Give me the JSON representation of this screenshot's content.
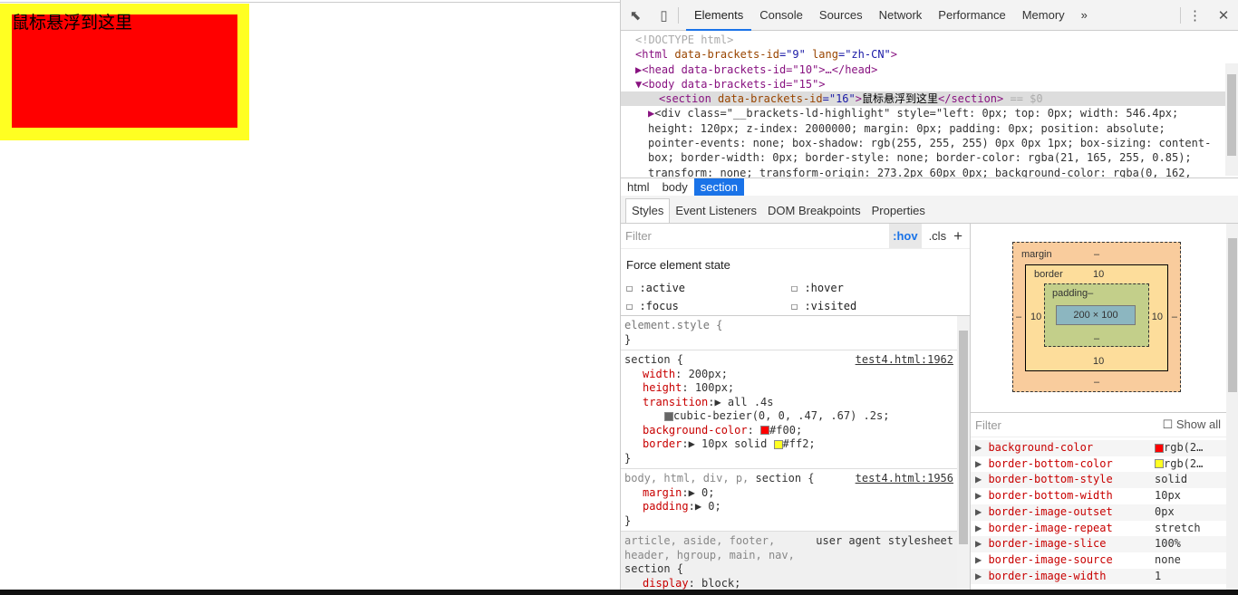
{
  "page": {
    "section_text": "鼠标悬浮到这里",
    "colors": {
      "background": "#ff0000",
      "border": "#ffff22"
    }
  },
  "devtools": {
    "tabs": [
      "Elements",
      "Console",
      "Sources",
      "Network",
      "Performance",
      "Memory"
    ],
    "more": "»",
    "dom": {
      "doctype": "<!DOCTYPE html>",
      "html_line": [
        "<html ",
        "data-brackets-id",
        "=\"9\" ",
        "lang",
        "=\"zh-CN\"",
        ">"
      ],
      "head_line": "<head data-brackets-id=\"10\">…</head>",
      "body_line": "<body data-brackets-id=\"15\">",
      "section_open": "<section ",
      "section_attr": "data-brackets-id",
      "section_val": "=\"16\"",
      "section_text": "鼠标悬浮到这里",
      "section_close": "</section>",
      "section_eq": " == $0",
      "div_lines": [
        "<div class=\"__brackets-ld-highlight\" style=\"left: 0px; top: 0px; width: 546.4px;",
        "height: 120px; z-index: 2000000; margin: 0px; padding: 0px; position: absolute;",
        "pointer-events: none; box-shadow: rgb(255, 255, 255) 0px 0px 1px; box-sizing: content-",
        "box; border-width: 0px; border-style: none; border-color: rgba(21, 165, 255, 0.85);",
        "transform: none; transform-origin: 273.2px 60px 0px; background-color: rgba(0, 162,"
      ]
    },
    "breadcrumbs": [
      "html",
      "body",
      "section"
    ],
    "subtabs": [
      "Styles",
      "Event Listeners",
      "DOM Breakpoints",
      "Properties"
    ],
    "styles": {
      "filter_placeholder": "Filter",
      "hov": ":hov",
      "cls": ".cls",
      "add": "+",
      "force_state": "Force element state",
      "states": [
        ":active",
        ":hover",
        ":focus",
        ":visited"
      ],
      "element_style": "element.style {",
      "close": "}",
      "rule1": {
        "selector": "section {",
        "source": "test4.html:1962",
        "props": [
          [
            "width",
            "200px;"
          ],
          [
            "height",
            "100px;"
          ],
          [
            "transition",
            "▶ all .4s"
          ]
        ],
        "bezier": "cubic-bezier(0, 0, .47, .67) .2s;",
        "bg": [
          "background-color",
          "#f00;"
        ],
        "border": [
          "border",
          "▶ 10px solid ",
          "#ff2;"
        ]
      },
      "rule2": {
        "selector_gray": "body, html, div, p, ",
        "selector": "section {",
        "source": "test4.html:1956",
        "props": [
          [
            "margin",
            "▶ 0;"
          ],
          [
            "padding",
            "▶ 0;"
          ]
        ]
      },
      "rule3": {
        "lines": [
          "article, aside, footer,",
          "header, hgroup, main, nav,"
        ],
        "selector": "section {",
        "source": "user agent stylesheet",
        "prop": [
          "display",
          "block;"
        ]
      }
    },
    "boxmodel": {
      "margin": "margin",
      "margin_val": "–",
      "border": "border",
      "border_val": "10",
      "padding": "padding–",
      "padding_bottom": "–",
      "content": "200 × 100",
      "left_m": "–",
      "left_b": "10",
      "right_b": "10",
      "right_m": "–",
      "bottom_b": "10",
      "bottom_m": "–"
    },
    "computed": {
      "filter_placeholder": "Filter",
      "show_all": "Show all",
      "props": [
        [
          "background-color",
          "rgb(2…",
          "#ff0000"
        ],
        [
          "border-bottom-color",
          "rgb(2…",
          "#ffff22"
        ],
        [
          "border-bottom-style",
          "solid",
          ""
        ],
        [
          "border-bottom-width",
          "10px",
          ""
        ],
        [
          "border-image-outset",
          "0px",
          ""
        ],
        [
          "border-image-repeat",
          "stretch",
          ""
        ],
        [
          "border-image-slice",
          "100%",
          ""
        ],
        [
          "border-image-source",
          "none",
          ""
        ],
        [
          "border-image-width",
          "1",
          ""
        ]
      ]
    }
  }
}
